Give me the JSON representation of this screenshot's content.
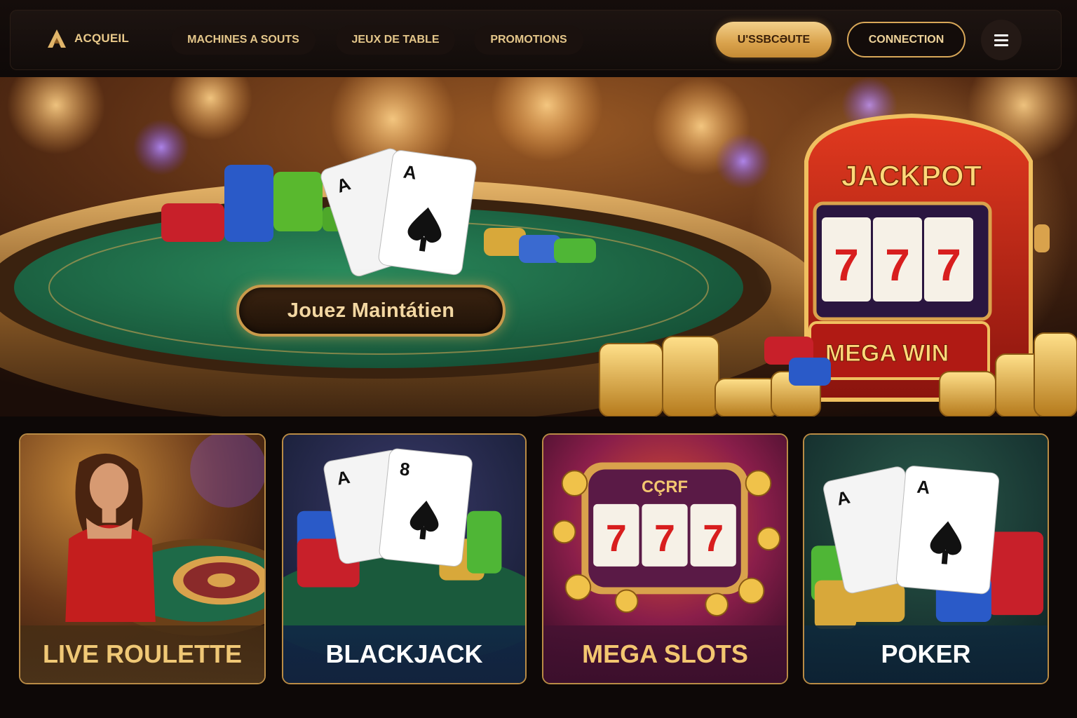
{
  "nav": {
    "brand_label": "ACQUEIL",
    "links": [
      "MACHINES A SOUTS",
      "JEUX DE TABLE",
      "PROMOTIONS"
    ],
    "subscribe_label": "U'SSBCƏUTE",
    "connection_label": "CONNECTION"
  },
  "hero": {
    "cta_label": "Jouez Maintátien",
    "jackpot_text": "JACKPOT",
    "mega_win_text": "MEGA WIN",
    "reels": [
      "7",
      "7",
      "7"
    ],
    "cards": [
      "A",
      "A"
    ]
  },
  "games": [
    {
      "label": "LIVE ROULETTE"
    },
    {
      "label": "BLACKJACK",
      "cards": [
        "A",
        "8"
      ]
    },
    {
      "label": "MEGA SLOTS",
      "sign": "CÇRF",
      "reels": [
        "7",
        "7",
        "7"
      ]
    },
    {
      "label": "POKER",
      "cards": [
        "A",
        "A"
      ]
    }
  ],
  "colors": {
    "gold": "#d9a24c",
    "felt": "#1e6a48",
    "background": "#0d0807"
  }
}
